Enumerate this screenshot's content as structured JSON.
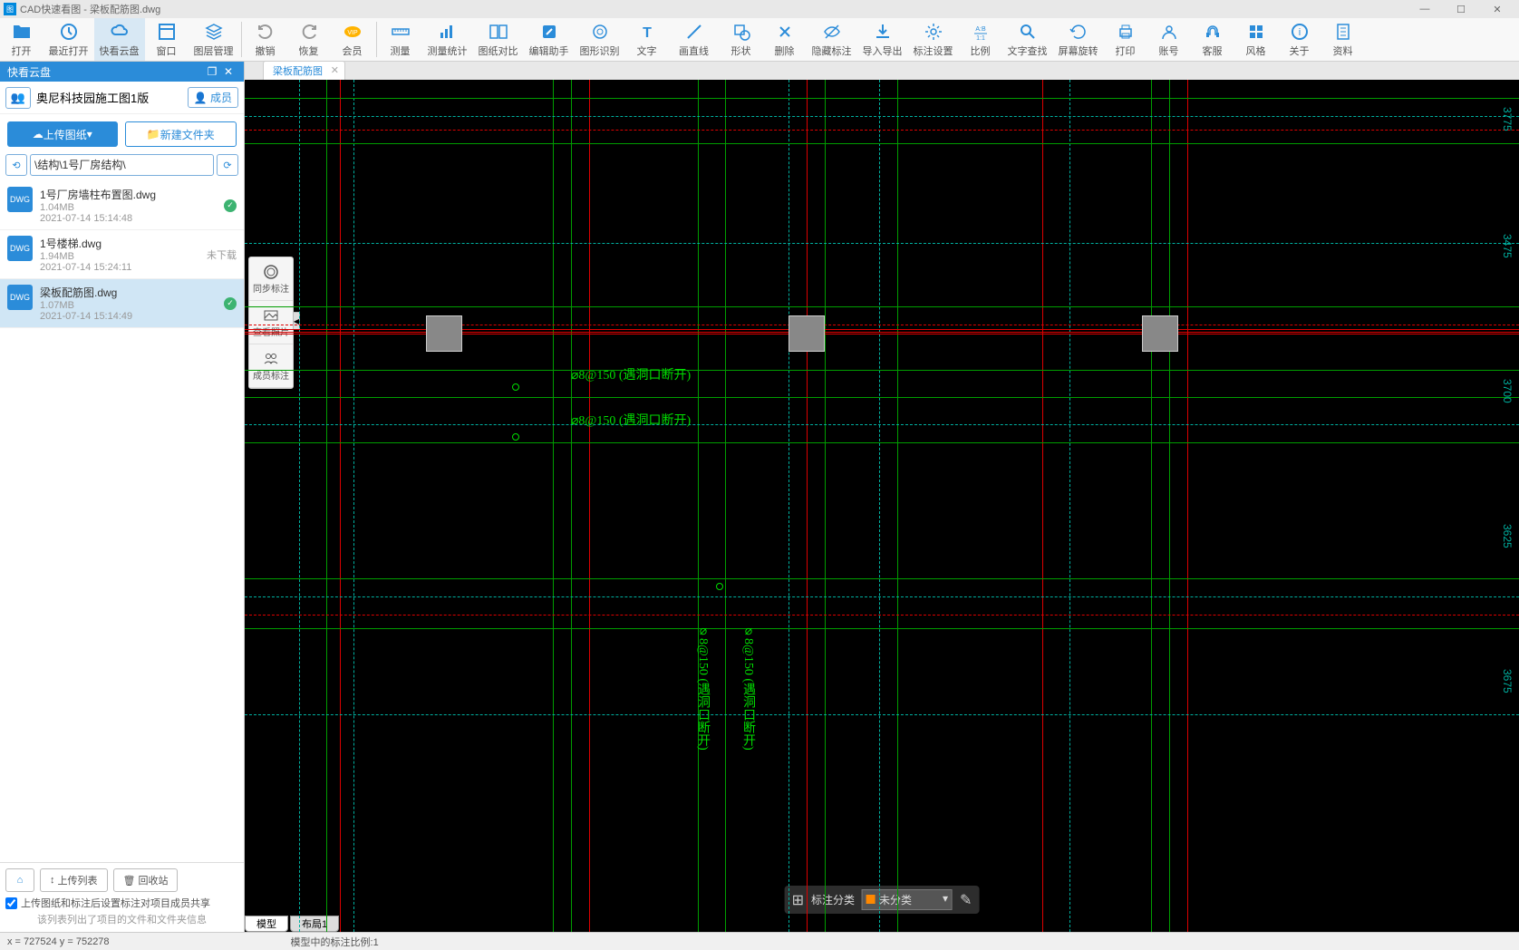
{
  "title": "CAD快速看图 - 梁板配筋图.dwg",
  "toolbar": [
    {
      "label": "打开",
      "icon": "folder"
    },
    {
      "label": "最近打开",
      "icon": "clock"
    },
    {
      "label": "快看云盘",
      "icon": "cloud",
      "active": true
    },
    {
      "label": "窗口",
      "icon": "window"
    },
    {
      "label": "图层管理",
      "icon": "layers"
    },
    {
      "label": "撤销",
      "icon": "undo"
    },
    {
      "label": "恢复",
      "icon": "redo"
    },
    {
      "label": "会员",
      "icon": "vip"
    },
    {
      "label": "测量",
      "icon": "ruler"
    },
    {
      "label": "测量统计",
      "icon": "stats"
    },
    {
      "label": "图纸对比",
      "icon": "compare"
    },
    {
      "label": "编辑助手",
      "icon": "edit"
    },
    {
      "label": "图形识别",
      "icon": "recognize"
    },
    {
      "label": "文字",
      "icon": "text"
    },
    {
      "label": "画直线",
      "icon": "line"
    },
    {
      "label": "形状",
      "icon": "shape"
    },
    {
      "label": "删除",
      "icon": "delete"
    },
    {
      "label": "隐藏标注",
      "icon": "hide"
    },
    {
      "label": "导入导出",
      "icon": "import"
    },
    {
      "label": "标注设置",
      "icon": "settings"
    },
    {
      "label": "比例",
      "icon": "scale"
    },
    {
      "label": "文字查找",
      "icon": "find"
    },
    {
      "label": "屏幕旋转",
      "icon": "rotate"
    },
    {
      "label": "打印",
      "icon": "print"
    },
    {
      "label": "账号",
      "icon": "account"
    },
    {
      "label": "客服",
      "icon": "support"
    },
    {
      "label": "风格",
      "icon": "style"
    },
    {
      "label": "关于",
      "icon": "about"
    },
    {
      "label": "资料",
      "icon": "docs"
    }
  ],
  "panel": {
    "title": "快看云盘",
    "project": "奥尼科技园施工图1版",
    "members": "成员",
    "upload": "上传图纸",
    "new_folder": "新建文件夹",
    "path": "\\结构\\1号厂房结构\\"
  },
  "files": [
    {
      "name": "1号厂房墙柱布置图.dwg",
      "size": "1.04MB",
      "time": "2021-07-14 15:14:48",
      "status": "synced"
    },
    {
      "name": "1号楼梯.dwg",
      "size": "1.94MB",
      "time": "2021-07-14 15:24:11",
      "status": "未下载"
    },
    {
      "name": "梁板配筋图.dwg",
      "size": "1.07MB",
      "time": "2021-07-14 15:14:49",
      "status": "synced",
      "selected": true
    }
  ],
  "bottom": {
    "upload_list": "上传列表",
    "recycle": "回收站",
    "share_check": "上传图纸和标注后设置标注对项目成员共享",
    "hint": "该列表列出了项目的文件和文件夹信息"
  },
  "tab": "梁板配筋图",
  "float_tools": [
    "同步标注",
    "查看照片",
    "成员标注"
  ],
  "overlay": {
    "label": "标注分类",
    "value": "未分类"
  },
  "model_tabs": [
    "模型",
    "布局1"
  ],
  "status": {
    "coords": "x = 727524 y = 752278",
    "scale": "模型中的标注比例:1"
  },
  "cad_annotations": {
    "text1": "⌀8@150 (遇洞口断开)",
    "text2": "⌀8@150 (遇洞口断开)",
    "text_v1": "⌀8@150 (遇洞口断开)",
    "text_v2": "⌀8@150 (遇洞口断开)",
    "dims": [
      "3775",
      "3475",
      "3700",
      "3625",
      "3675"
    ]
  }
}
